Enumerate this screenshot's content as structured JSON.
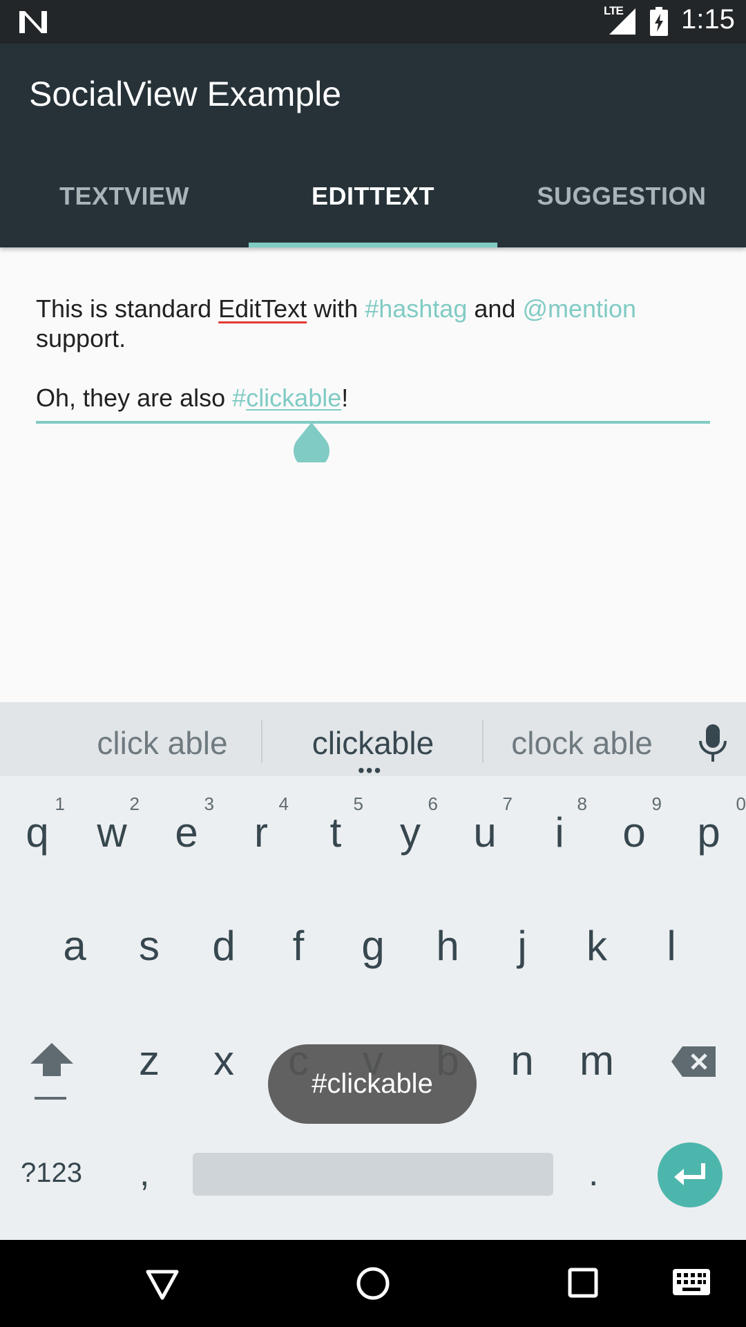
{
  "status_bar": {
    "network": "LTE",
    "time": "1:15"
  },
  "app_bar": {
    "title": "SocialView Example",
    "tabs": [
      {
        "label": "TEXTVIEW",
        "active": false
      },
      {
        "label": "EDITTEXT",
        "active": true
      },
      {
        "label": "SUGGESTION",
        "active": false
      }
    ]
  },
  "edit_text": {
    "line1": {
      "t1": "This is standard ",
      "spell": "EditText",
      "t2": " with ",
      "hashtag": "#hashtag",
      "t3": " and ",
      "mention": "@mention",
      "t4": "support."
    },
    "line2": {
      "t1": "Oh, they are also ",
      "hash": "#",
      "link": "clickable",
      "t2": "!"
    }
  },
  "keyboard": {
    "suggestions": [
      "click able",
      "clickable",
      "clock able"
    ],
    "more_dots": "•••",
    "row1": [
      {
        "k": "q",
        "h": "1"
      },
      {
        "k": "w",
        "h": "2"
      },
      {
        "k": "e",
        "h": "3"
      },
      {
        "k": "r",
        "h": "4"
      },
      {
        "k": "t",
        "h": "5"
      },
      {
        "k": "y",
        "h": "6"
      },
      {
        "k": "u",
        "h": "7"
      },
      {
        "k": "i",
        "h": "8"
      },
      {
        "k": "o",
        "h": "9"
      },
      {
        "k": "p",
        "h": "0"
      }
    ],
    "row2": [
      "a",
      "s",
      "d",
      "f",
      "g",
      "h",
      "j",
      "k",
      "l"
    ],
    "row3": [
      "z",
      "x",
      "c",
      "v",
      "b",
      "n",
      "m"
    ],
    "symbols_label": "?123",
    "comma": ",",
    "period": "."
  },
  "toast": "#clickable",
  "colors": {
    "accent": "#80cbc4",
    "app_bar": "#263238",
    "enter": "#4db6ac",
    "spell_error": "#e53935"
  }
}
